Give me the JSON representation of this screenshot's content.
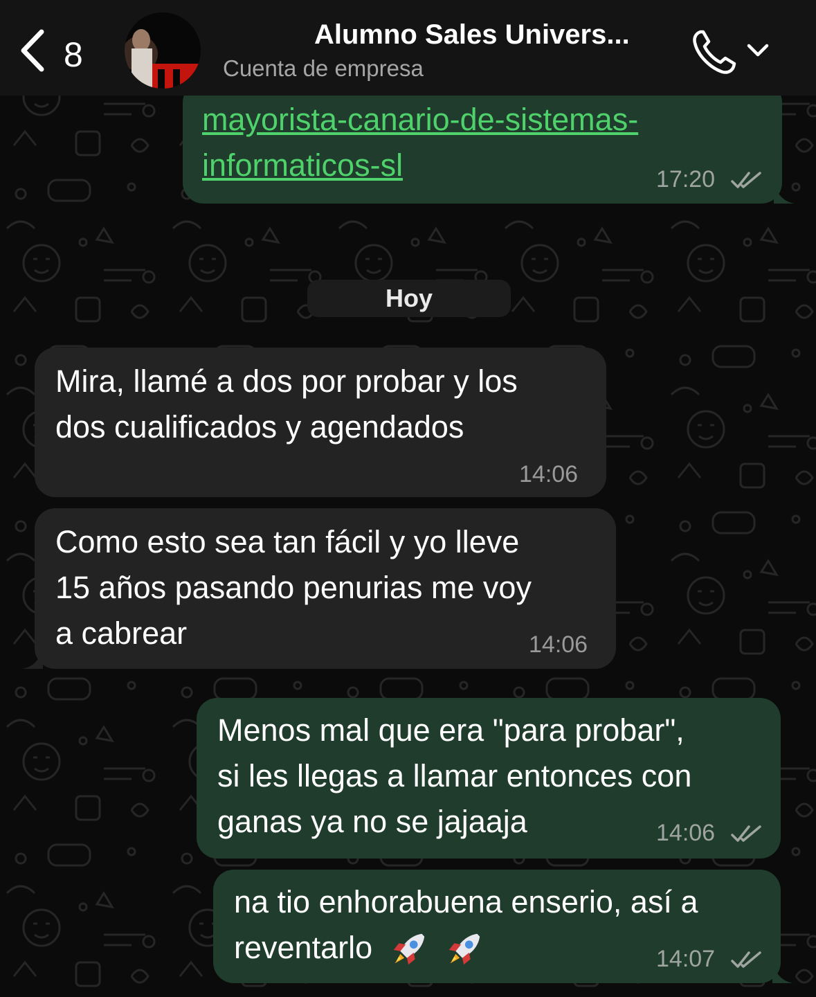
{
  "header": {
    "back_count": "8",
    "contact_name": "Alumno Sales Univers...",
    "contact_subtitle": "Cuenta de empresa"
  },
  "date_divider": "Hoy",
  "messages": [
    {
      "direction": "outgoing",
      "lines": [
        "mayorista-canario-de-sistemas-",
        "informaticos-sl"
      ],
      "is_link": true,
      "time": "17:20",
      "status": "read"
    },
    {
      "direction": "incoming",
      "lines": [
        "Mira, llamé a dos por probar y los",
        "dos cualificados y agendados"
      ],
      "time": "14:06"
    },
    {
      "direction": "incoming",
      "lines": [
        "Como esto sea tan fácil y yo lleve",
        "15 años pasando penurias me voy",
        "a cabrear"
      ],
      "time": "14:06"
    },
    {
      "direction": "outgoing",
      "lines": [
        "Menos mal que era \"para probar\",",
        "si les llegas a llamar entonces con",
        "ganas ya no se jajaaja"
      ],
      "time": "14:06",
      "status": "read"
    },
    {
      "direction": "outgoing",
      "lines": [
        "na tio enhorabuena enserio, así a",
        "reventarlo"
      ],
      "emoji": [
        "rocket-icon",
        "rocket-icon"
      ],
      "time": "14:07",
      "status": "read"
    }
  ],
  "colors": {
    "outgoing_bubble": "#1f3c2d",
    "incoming_bubble": "#232323",
    "link": "#4fd16b",
    "background": "#0b0b0b"
  }
}
